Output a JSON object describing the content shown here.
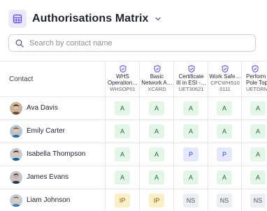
{
  "header": {
    "title": "Authorisations Matrix",
    "icon": "grid-icon",
    "dropdown_icon": "chevron-down-icon"
  },
  "search": {
    "placeholder": "Search by contact name",
    "value": ""
  },
  "table": {
    "contact_header": "Contact",
    "columns": [
      {
        "name": "WHS\nOperation…",
        "code": "WHSOP01"
      },
      {
        "name": "Basic\nNetwork A…",
        "code": "XCARD"
      },
      {
        "name": "Certificate\nIII in ESI -…",
        "code": "UET30621"
      },
      {
        "name": "Work Safe…",
        "code": "CPCWHS10\n0111"
      },
      {
        "name": "Perform\nPole Top…",
        "code": "UETDRMP"
      }
    ],
    "rows": [
      {
        "name": "Ava Davis",
        "avatar": "avatar-ava",
        "cells": [
          "A",
          "A",
          "A",
          "A",
          "A"
        ]
      },
      {
        "name": "Emily Carter",
        "avatar": "avatar-emily",
        "cells": [
          "A",
          "A",
          "A",
          "A",
          "A"
        ]
      },
      {
        "name": "Isabella Thompson",
        "avatar": "avatar-isabella",
        "cells": [
          "A",
          "A",
          "P",
          "P",
          "A"
        ]
      },
      {
        "name": "James Evans",
        "avatar": "avatar-james",
        "cells": [
          "A",
          "A",
          "A",
          "A",
          "A"
        ]
      },
      {
        "name": "Liam Johnson",
        "avatar": "avatar-liam",
        "cells": [
          "IP",
          "IP",
          "NS",
          "NS",
          "NS"
        ]
      }
    ]
  },
  "colors": {
    "accent": "#6b5bd6",
    "approved": "#e4f6e8",
    "pending": "#e6e9fb",
    "not_started": "#eceff3",
    "in_progress": "#fbefc9"
  }
}
